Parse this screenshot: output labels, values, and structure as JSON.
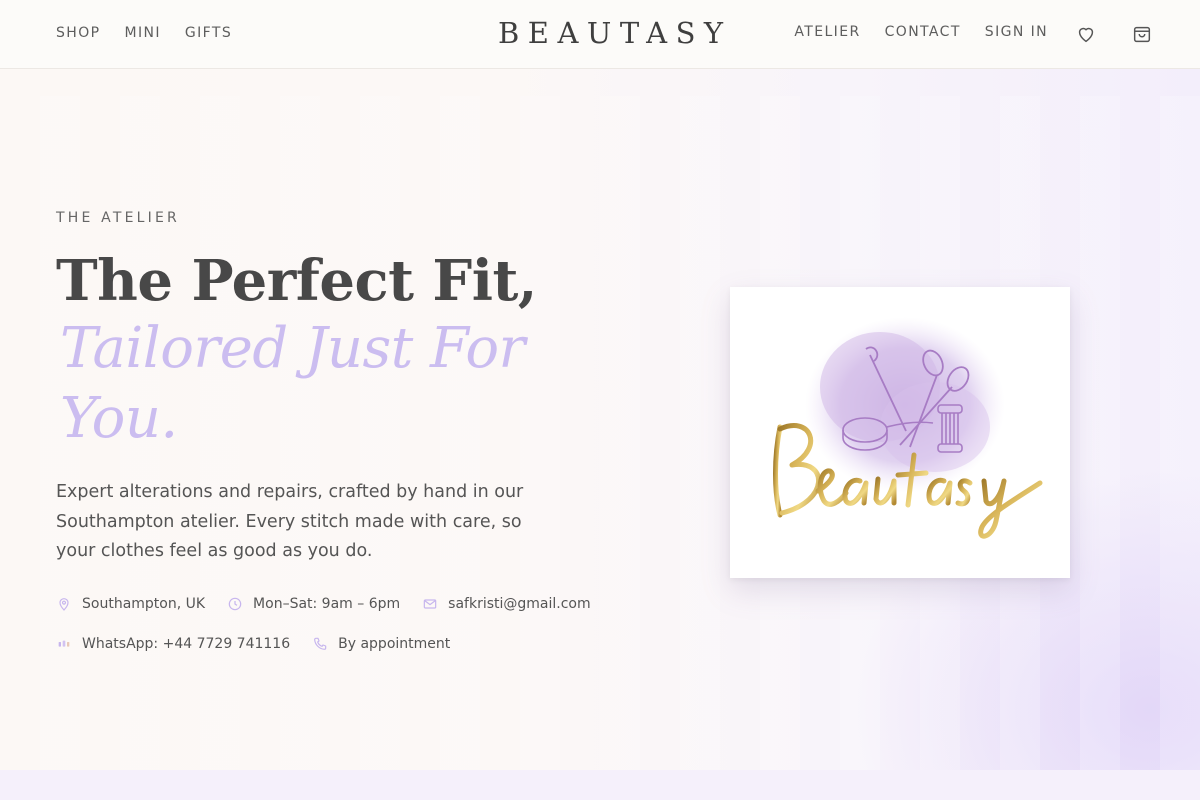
{
  "header": {
    "nav_left": [
      {
        "label": "SHOP"
      },
      {
        "label": "MINI"
      },
      {
        "label": "GIFTS"
      }
    ],
    "brand": "BEAUTASY",
    "nav_right": [
      {
        "label": "ATELIER"
      },
      {
        "label": "CONTACT"
      },
      {
        "label": "SIGN IN"
      }
    ],
    "icons": [
      "heart-icon",
      "shopping-bag-icon"
    ]
  },
  "hero": {
    "eyebrow": "THE ATELIER",
    "title_line_1": "The Perfect Fit,",
    "title_line_2": "Tailored Just For You.",
    "lede": "Expert alterations and repairs, crafted by hand in our Southampton atelier. Every stitch made with care, so your clothes feel as good as you do.",
    "contacts": [
      {
        "icon": "location-pin-icon",
        "text": "Southampton, UK"
      },
      {
        "icon": "clock-icon",
        "text": "Mon–Sat: 9am – 6pm"
      },
      {
        "icon": "mail-icon",
        "text": "safkristi@gmail.com"
      },
      {
        "icon": "whatsapp-icon",
        "text": "WhatsApp: +44 7729 741116"
      },
      {
        "icon": "phone-icon",
        "text": "By appointment"
      }
    ],
    "logo_image": {
      "wordmark": "Beautasy"
    }
  },
  "colors": {
    "accent_lavender": "#cbbdf0",
    "icon_lavender": "#c7b6ee",
    "logo_gold": "#c9a13c",
    "logo_purple": "#a77cc4",
    "text_dark": "#484848"
  }
}
